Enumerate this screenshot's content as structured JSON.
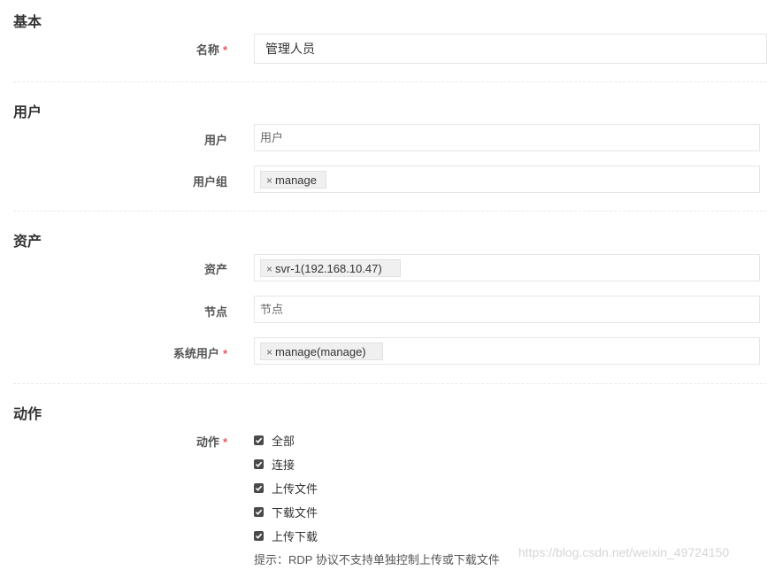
{
  "sections": {
    "basic": "基本",
    "user": "用户",
    "asset": "资产",
    "action": "动作"
  },
  "fields": {
    "name": {
      "label": "名称",
      "required": "*",
      "value": "管理人员"
    },
    "users": {
      "label": "用户",
      "placeholder": "用户"
    },
    "user_groups": {
      "label": "用户组",
      "tags": [
        "manage"
      ]
    },
    "assets": {
      "label": "资产",
      "tags": [
        "svr-1(192.168.10.47)"
      ]
    },
    "nodes": {
      "label": "节点",
      "placeholder": "节点"
    },
    "system_users": {
      "label": "系统用户",
      "required": "*",
      "tags": [
        "manage(manage)"
      ]
    },
    "actions": {
      "label": "动作",
      "required": "*",
      "options": [
        {
          "label": "全部",
          "checked": true
        },
        {
          "label": "连接",
          "checked": true
        },
        {
          "label": "上传文件",
          "checked": true
        },
        {
          "label": "下载文件",
          "checked": true
        },
        {
          "label": "上传下载",
          "checked": true
        }
      ],
      "hint": "提示：RDP 协议不支持单独控制上传或下载文件"
    }
  },
  "tag_remove_symbol": "×",
  "watermark": "https://blog.csdn.net/weixin_49724150"
}
